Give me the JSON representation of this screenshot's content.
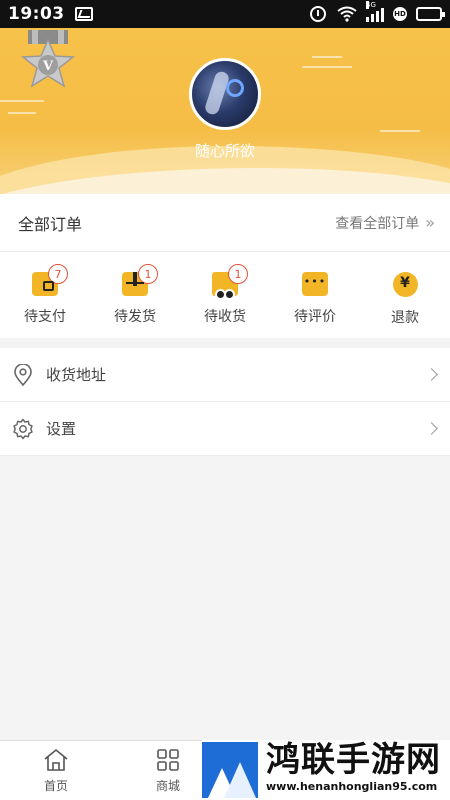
{
  "status_bar": {
    "time": "19:03",
    "network_tag": "4G",
    "hd_label": "HD",
    "battery_level": 0.95,
    "icons": [
      "image-icon",
      "alarm-icon",
      "wifi-icon",
      "signal-icon",
      "hd-icon",
      "battery-icon"
    ]
  },
  "profile": {
    "nickname": "随心所欲",
    "medal_letter": "V",
    "colors": {
      "banner": "#f5bd45",
      "accent": "#f2b526",
      "badge": "#e0533b"
    }
  },
  "orders": {
    "title": "全部订单",
    "view_all": "查看全部订单",
    "items": [
      {
        "label": "待支付",
        "icon": "wallet-icon",
        "count": "7"
      },
      {
        "label": "待发货",
        "icon": "package-icon",
        "count": "1"
      },
      {
        "label": "待收货",
        "icon": "truck-icon",
        "count": "1"
      },
      {
        "label": "待评价",
        "icon": "comment-icon",
        "count": ""
      },
      {
        "label": "退款",
        "icon": "refund-icon",
        "count": ""
      }
    ]
  },
  "menu": {
    "items": [
      {
        "label": "收货地址",
        "icon": "location-icon"
      },
      {
        "label": "设置",
        "icon": "gear-icon"
      }
    ]
  },
  "bottom_nav": {
    "items": [
      {
        "label": "首页",
        "icon": "home-icon"
      },
      {
        "label": "商城",
        "icon": "grid-icon"
      }
    ]
  },
  "watermark": {
    "title": "鸿联手游网",
    "url": "www.henanhonglian95.com"
  }
}
